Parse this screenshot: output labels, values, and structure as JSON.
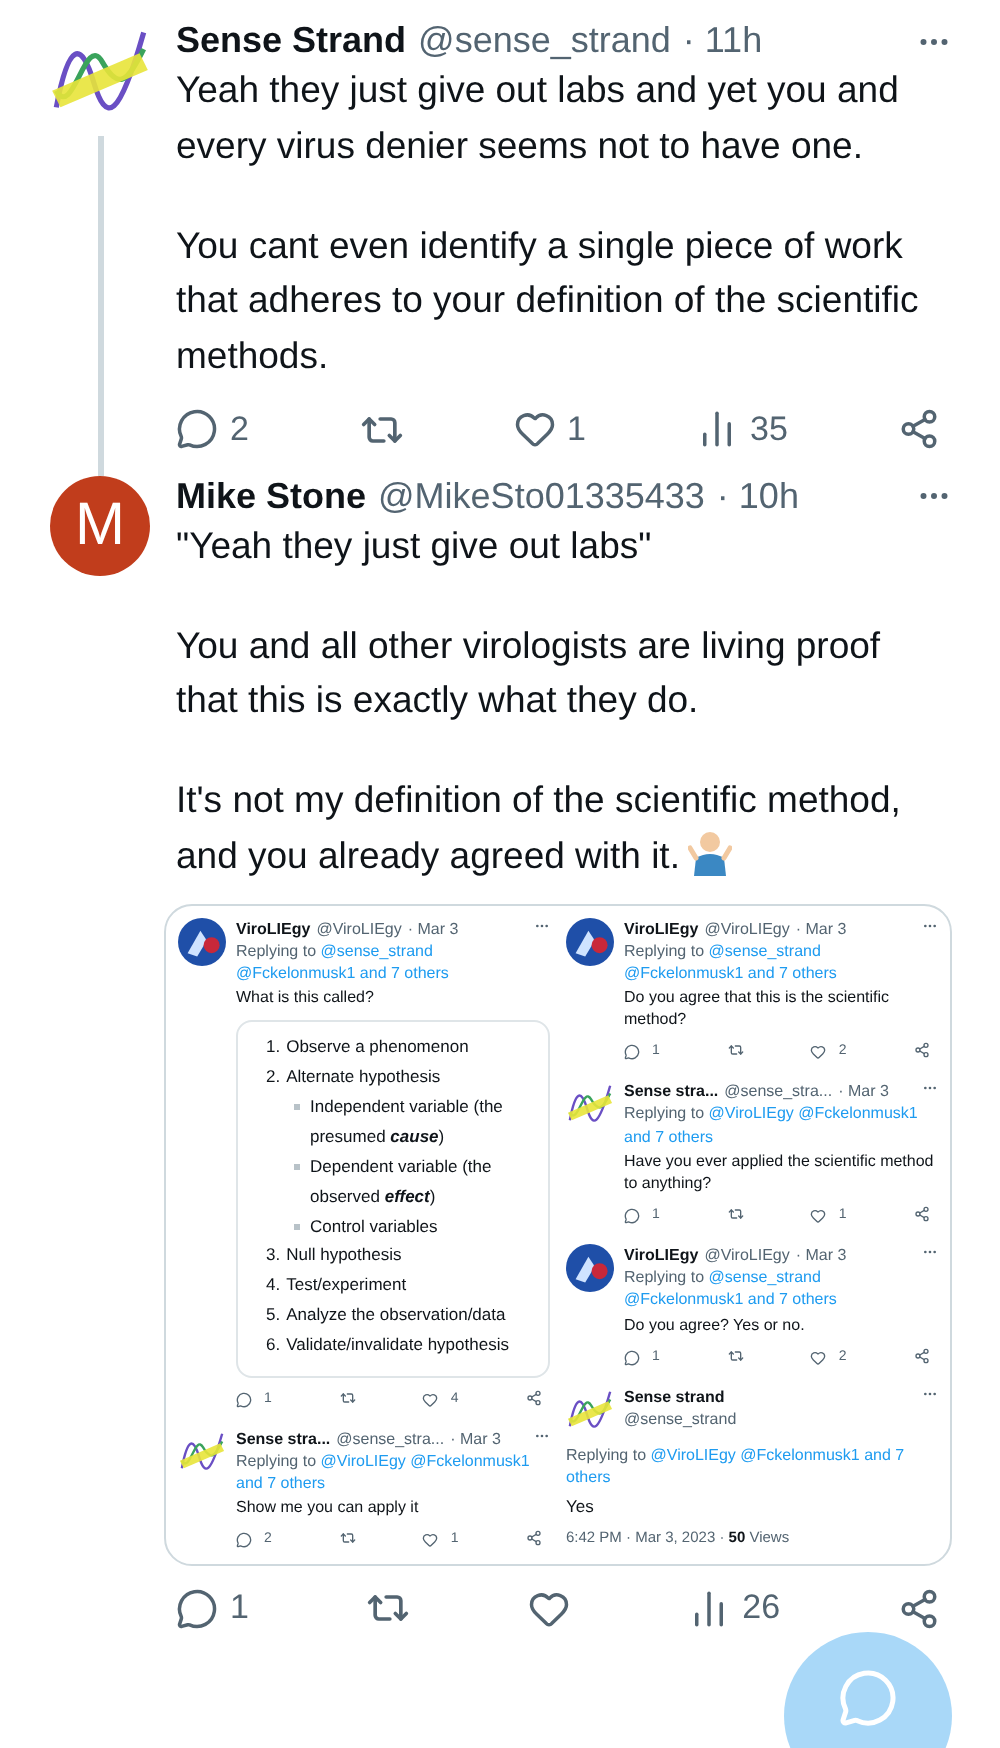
{
  "thread": [
    {
      "avatar": {
        "kind": "logo"
      },
      "name": "Sense Strand",
      "handle": "@sense_strand",
      "time": "· 11h",
      "thread_line": true,
      "paragraphs": [
        "Yeah they just give out labs and yet you and every virus denier seems not to have one.",
        "You cant even identify a single piece of work that adheres to your definition of the scientific methods."
      ],
      "stats": {
        "replies": "2",
        "likes": "1",
        "views": "35"
      }
    },
    {
      "avatar": {
        "kind": "letter",
        "text": "M"
      },
      "name": "Mike Stone",
      "handle": "@MikeSto01335433",
      "time": "· 10h",
      "thread_line": false,
      "paragraphs": [
        "\"Yeah they just give out labs\"",
        "You and all other virologists are living proof that this is exactly what they do.",
        "It's not my definition of the scientific method, and you already agreed with it."
      ],
      "end_mark": {
        "kind": "shrug"
      },
      "attachment": {
        "kind": "screenshot",
        "columns": [
          [
            {
              "kind": "reply",
              "avatar": {
                "kind": "virus"
              },
              "name": "ViroLIEgy",
              "handle": "@ViroLIEgy",
              "time": "· Mar 3",
              "replying_label": "Replying to",
              "mentions": "@sense_strand @Fckelonmusk1 and 7 others",
              "text": "What is this called?",
              "list": [
                {
                  "marker": "1.",
                  "text": "Observe a phenomenon"
                },
                {
                  "marker": "2.",
                  "text": "Alternate hypothesis",
                  "children": [
                    {
                      "text": "Independent variable (the presumed **cause**)"
                    },
                    {
                      "text": "Dependent variable (the observed **effect**)"
                    },
                    {
                      "text": "Control variables"
                    }
                  ]
                },
                {
                  "marker": "3.",
                  "text": "Null hypothesis"
                },
                {
                  "marker": "4.",
                  "text": "Test/experiment"
                },
                {
                  "marker": "5.",
                  "text": "Analyze the observation/data"
                },
                {
                  "marker": "6.",
                  "text": "Validate/invalidate hypothesis"
                }
              ],
              "stats": {
                "replies": "1",
                "likes": "4"
              }
            },
            {
              "kind": "reply",
              "avatar": {
                "kind": "logo"
              },
              "name": "Sense stra...",
              "handle": "@sense_stra...",
              "time": "· Mar 3",
              "replying_label": "Replying to",
              "mentions": "@ViroLIEgy @Fckelonmusk1 and 7 others",
              "text": "Show me you can apply it",
              "stats": {
                "replies": "2",
                "likes": "1"
              }
            }
          ],
          [
            {
              "kind": "reply",
              "avatar": {
                "kind": "virus"
              },
              "name": "ViroLIEgy",
              "handle": "@ViroLIEgy",
              "time": "· Mar 3",
              "replying_label": "Replying to",
              "mentions": "@sense_strand @Fckelonmusk1 and 7 others",
              "text": "Do you agree that this is the scientific method?",
              "stats": {
                "replies": "1",
                "likes": "2"
              }
            },
            {
              "kind": "reply",
              "avatar": {
                "kind": "logo"
              },
              "name": "Sense stra...",
              "handle": "@sense_stra...",
              "time": "· Mar 3",
              "replying_label": "Replying to",
              "mentions": "@ViroLIEgy @Fckelonmusk1 and 7 others",
              "text": "Have you ever applied the scientific method to anything?",
              "stats": {
                "replies": "1",
                "likes": "1"
              }
            },
            {
              "kind": "reply",
              "avatar": {
                "kind": "virus"
              },
              "name": "ViroLIEgy",
              "handle": "@ViroLIEgy",
              "time": "· Mar 3",
              "replying_label": "Replying to",
              "mentions": "@sense_strand @Fckelonmusk1 and 7 others",
              "text": "Do you agree? Yes or no.",
              "stats": {
                "replies": "1",
                "likes": "2"
              }
            },
            {
              "kind": "focus",
              "avatar": {
                "kind": "logo"
              },
              "name": "Sense strand",
              "handle": "@sense_strand",
              "replying_label": "Replying to",
              "mentions": "@ViroLIEgy @Fckelonmusk1 and 7 others",
              "text": "Yes",
              "meta": "6:42 PM · Mar 3, 2023 · **50** Views"
            }
          ]
        ]
      },
      "stats": {
        "replies": "1",
        "views": "26"
      }
    }
  ],
  "compose_button": {
    "kind": "floating"
  }
}
